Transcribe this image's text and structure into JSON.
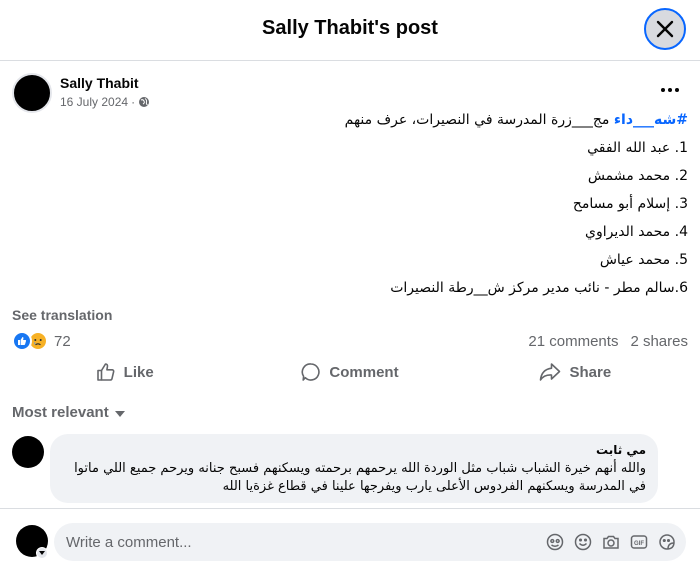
{
  "header": {
    "title": "Sally Thabit's post"
  },
  "post": {
    "author": "Sally Thabit",
    "date": "16 July 2024",
    "audience_icon": "globe-icon",
    "hashtag": "#شه___داء",
    "intro": " مج___زرة المدرسة في النصيرات، عرف منهم",
    "lines": [
      "1. عبد الله الفقي",
      "2. محمد مشمش",
      "3. إسلام أبو مسامح",
      "4. محمد الديراوي",
      "5. محمد عياش",
      "6.سالم مطر - نائب مدير مركز ش__رطة النصيرات"
    ],
    "see_translation": "See translation"
  },
  "stats": {
    "reaction_count": "72",
    "comments": "21 comments",
    "shares": "2 shares"
  },
  "actions": {
    "like": "Like",
    "comment": "Comment",
    "share": "Share"
  },
  "comments_section": {
    "sort_label": "Most relevant",
    "comment": {
      "author": "مي ثابت",
      "text": "والله أنهم خيرة الشباب شباب مثل الوردة الله يرحمهم برحمته ويسكنهم فسبح جنانه ويرحم جميع اللي ماتوا في المدرسة ويسكنهم الفردوس الأعلى يارب ويفرجها علينا في قطاع غزةيا الله"
    }
  },
  "composer": {
    "placeholder": "Write a comment...",
    "icons": [
      "avatar-sticker-icon",
      "emoji-icon",
      "camera-icon",
      "gif-icon",
      "sticker-icon"
    ]
  },
  "colors": {
    "accent": "#0866ff",
    "secondary_text": "#65676b",
    "bubble": "#f0f2f5"
  }
}
